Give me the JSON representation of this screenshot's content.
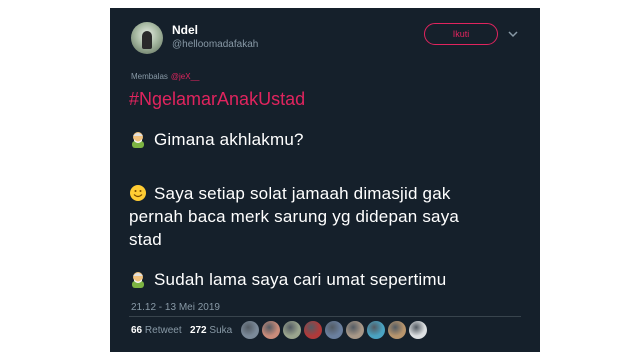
{
  "tweet": {
    "display_name": "Ndel",
    "handle": "@helloomadafakah",
    "follow_label": "Ikuti",
    "reply_prefix": "Membalas",
    "reply_to": "@jeX__",
    "hashtag": "#NgelamarAnakUstad",
    "lines": [
      {
        "speaker_icon": "old-man-emoji-icon",
        "text": "Gimana akhlakmu?"
      },
      {
        "speaker_icon": "smiling-face-emoji-icon",
        "text": "Saya setiap solat jamaah dimasjid gak"
      },
      {
        "speaker_icon": "",
        "text": "pernah baca merk sarung yg didepan saya"
      },
      {
        "speaker_icon": "",
        "text": "stad"
      },
      {
        "speaker_icon": "old-man-emoji-icon",
        "text": "Sudah lama saya cari umat sepertimu"
      }
    ],
    "timestamp": "21.12 - 13 Mei 2019",
    "retweet_count": "66",
    "retweet_label": "Retweet",
    "like_count": "272",
    "like_label": "Suka"
  },
  "colors": {
    "card_bg": "#15202b",
    "accent": "#e0245e",
    "muted": "#8899a6",
    "text": "#ffffff"
  },
  "likers": [
    "#7b8a99",
    "#c98b7a",
    "#9aa58e",
    "#b03a3a",
    "#6a7f9e",
    "#a89888",
    "#4aa3c2",
    "#b8956d",
    "#dde0e2"
  ]
}
